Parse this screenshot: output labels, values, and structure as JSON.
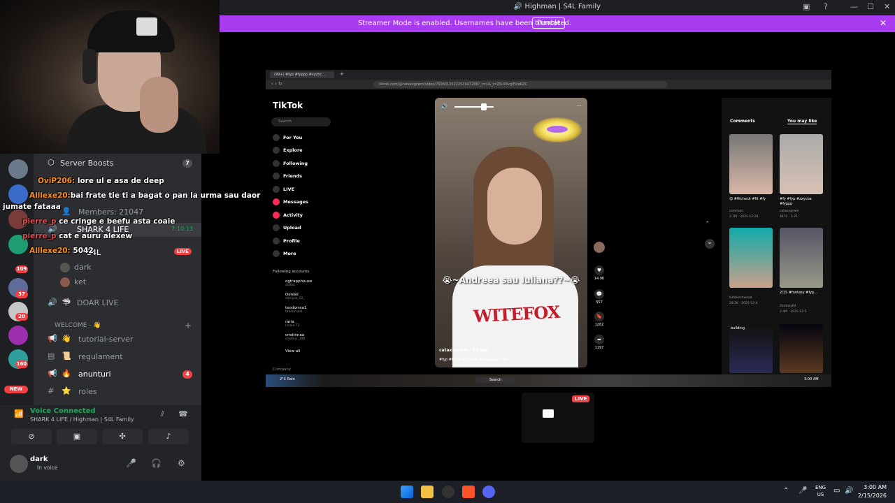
{
  "window": {
    "title": "Highman | S4L Family",
    "banner_text": "Streamer Mode is enabled. Usernames have been truncated.",
    "banner_button": "Disable"
  },
  "sidebar": {
    "server_boosts": "Server Boosts",
    "server_boosts_count": "7",
    "members": "Members: 21047",
    "voice_channel": "SHARK 4 LIFE",
    "voice_timer": "7:10:13",
    "live_user": "S4L",
    "live_badge": "LIVE",
    "voice_users": [
      "dark",
      "ket"
    ],
    "channel_doar": "DOAR LIVE",
    "category_welcome": "WELCOME - 👋",
    "channels": [
      {
        "name": "tutorial-server",
        "emoji": "👋",
        "badge": ""
      },
      {
        "name": "regulament",
        "emoji": "📜",
        "badge": ""
      },
      {
        "name": "anunturi",
        "emoji": "🔥",
        "badge": "4"
      },
      {
        "name": "roles",
        "emoji": "⭐",
        "badge": ""
      }
    ],
    "guild_badges": [
      "109",
      "37",
      "20",
      "160"
    ],
    "new_badge": "NEW"
  },
  "chat": [
    {
      "user": "OviP206:",
      "text": "lore ul e asa de deep"
    },
    {
      "user": "Alllexe20:",
      "text": "bai frate tie ti a bagat o pan la urma sau daor"
    },
    {
      "user": "",
      "text": "jumate fataaa"
    },
    {
      "user": "pierre_p",
      "text": "ce cringe e beefu asta coaie"
    },
    {
      "user": "pierre_p",
      "text": "cat e auru alexew"
    },
    {
      "user": "Alllexe20:",
      "text": "5042"
    }
  ],
  "voice": {
    "status": "Voice Connected",
    "sub": "SHARK 4 LIFE / Highman | S4L Family"
  },
  "user": {
    "name": "dark",
    "status": "In voice"
  },
  "stream": {
    "tab_title": "(99+) #fyp #fyppp #xyzbc...",
    "url": "tiktok.com/@cataxxgrwm/video/7606012522251947286?_r=1&_t=ZN-93vgiFVwKZC",
    "tiktok": {
      "logo": "TikTok",
      "search_placeholder": "Search",
      "nav": [
        "For You",
        "Explore",
        "Following",
        "Friends",
        "LIVE",
        "Messages",
        "Activity",
        "Upload",
        "Profile",
        "More"
      ],
      "following_title": "Following accounts",
      "following": [
        {
          "name": "ogtrapphouse",
          "sub": "al10st"
        },
        {
          "name": "Denise",
          "sub": "deniysa_02_"
        },
        {
          "name": "teodorraa1",
          "sub": "teodorraa1"
        },
        {
          "name": "raria",
          "sub": "raraia.73"
        },
        {
          "name": "cristinnaa",
          "sub": "cristina__0f8"
        }
      ],
      "view_all": "View all",
      "company": "Company",
      "video_caption": "😭~Andreea sau Iuliana??~😭",
      "video_user": "cataxxgrwm",
      "video_time": "2d ago",
      "video_tags": "#fyp #fyppp #zxycba #catxxgrwm #fy",
      "shirt_text": "WITEFOX",
      "actions": [
        "14.9K",
        "557",
        "1262",
        "1197"
      ],
      "right_tabs": [
        "Comments",
        "You may like"
      ],
      "suggestions": [
        {
          "caption": "😊 #fitcheck #fit #fy",
          "user": "csmiluon",
          "meta": "2.7M · 2025-12-28"
        },
        {
          "caption": "#fy #fyp #zxycba #fyppp",
          "user": "cataxxgrwm",
          "meta": "4472 · 1-21"
        },
        {
          "caption": "",
          "user": "kimbiechwood",
          "meta": "28.3K · 2025-12-4"
        },
        {
          "caption": "2/15 #fantasy #fyp...",
          "user": "ifantasy64",
          "meta": "2.4M · 2025-12-5"
        }
      ],
      "suggestion_caption_bottom": "building."
    },
    "inner_taskbar": {
      "weather": "2°C Rain",
      "search": "Search",
      "time": "3:00 AM"
    }
  },
  "preview_live": "LIVE",
  "taskbar": {
    "lang_top": "ENG",
    "lang_bottom": "US",
    "time": "3:00 AM",
    "date": "2/15/2026"
  },
  "colors": {
    "banner": "#a93cf0",
    "live": "#f23f43",
    "voice_green": "#23a55a"
  }
}
